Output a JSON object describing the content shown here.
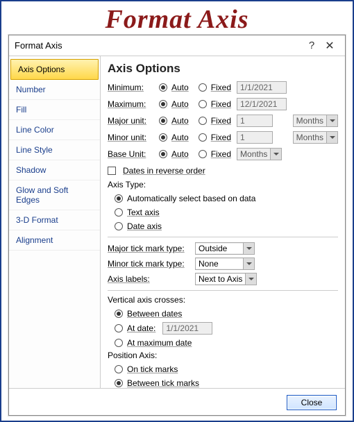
{
  "page_title": "Format Axis",
  "dialog": {
    "title": "Format Axis",
    "sidebar": {
      "items": [
        "Axis Options",
        "Number",
        "Fill",
        "Line Color",
        "Line Style",
        "Shadow",
        "Glow and Soft Edges",
        "3-D Format",
        "Alignment"
      ],
      "selected": 0
    },
    "panel": {
      "heading": "Axis Options",
      "rows": {
        "minimum": {
          "label": "Minimum:",
          "auto": "Auto",
          "fixed": "Fixed",
          "value": "1/1/2021",
          "selected": "auto"
        },
        "maximum": {
          "label": "Maximum:",
          "auto": "Auto",
          "fixed": "Fixed",
          "value": "12/1/2021",
          "selected": "auto"
        },
        "major_unit": {
          "label": "Major unit:",
          "auto": "Auto",
          "fixed": "Fixed",
          "value": "1",
          "unit": "Months",
          "selected": "auto"
        },
        "minor_unit": {
          "label": "Minor unit:",
          "auto": "Auto",
          "fixed": "Fixed",
          "value": "1",
          "unit": "Months",
          "selected": "auto"
        },
        "base_unit": {
          "label": "Base Unit:",
          "auto": "Auto",
          "fixed": "Fixed",
          "unit": "Months",
          "selected": "auto"
        }
      },
      "reverse_label": "Dates in reverse order",
      "axis_type": {
        "label": "Axis Type:",
        "opt_auto": "Automatically select based on data",
        "opt_text": "Text axis",
        "opt_date": "Date axis",
        "selected": "auto"
      },
      "major_tick": {
        "label": "Major tick mark type:",
        "value": "Outside"
      },
      "minor_tick": {
        "label": "Minor tick mark type:",
        "value": "None"
      },
      "axis_labels": {
        "label": "Axis labels:",
        "value": "Next to Axis"
      },
      "vcross": {
        "label": "Vertical axis crosses:",
        "opt_between": "Between dates",
        "opt_at": "At date:",
        "at_value": "1/1/2021",
        "opt_max": "At maximum date",
        "selected": "between"
      },
      "pos_axis": {
        "label": "Position Axis:",
        "opt_on": "On tick marks",
        "opt_between": "Between tick marks",
        "selected": "between"
      }
    },
    "close": "Close"
  }
}
